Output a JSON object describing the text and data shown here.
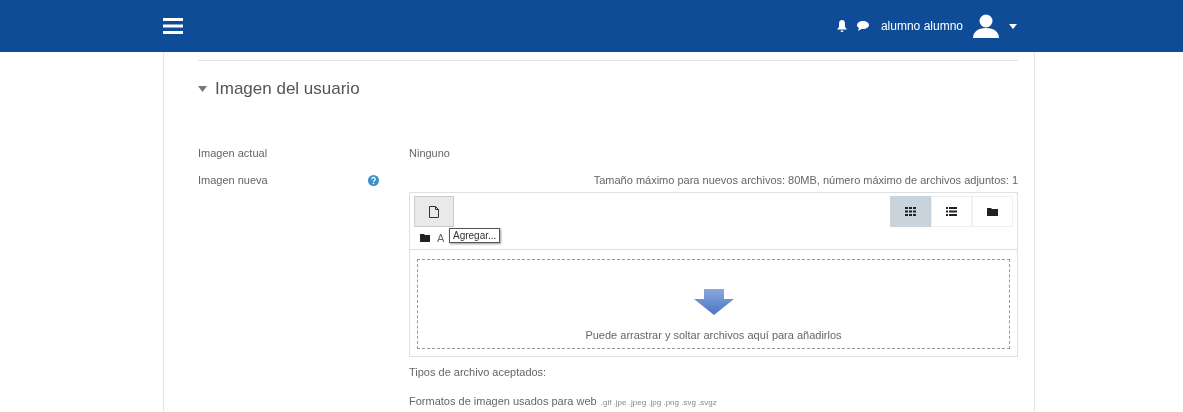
{
  "navbar": {
    "user_name": "alumno alumno"
  },
  "section": {
    "title": "Imagen del usuario",
    "expanded": true
  },
  "fields": [
    {
      "label": "Imagen actual",
      "value": "Ninguno"
    },
    {
      "label": "Imagen nueva",
      "help": true
    }
  ],
  "filepicker": {
    "limits": "Tamaño máximo para nuevos archivos: 80MB, número máximo de archivos adjuntos: 1",
    "path": "A",
    "tooltip": "Agregar...",
    "views": [
      {
        "kind": "icons",
        "selected": true
      },
      {
        "kind": "list",
        "selected": false
      },
      {
        "kind": "tree",
        "selected": false
      }
    ],
    "drop_text": "Puede arrastrar y soltar archivos aquí para añadirlos"
  },
  "accepted": {
    "heading": "Tipos de archivo aceptados:",
    "type_name": "Formatos de imagen usados para web",
    "extensions": ".gif .jpe .jpeg .jpg .png .svg .svgz"
  }
}
